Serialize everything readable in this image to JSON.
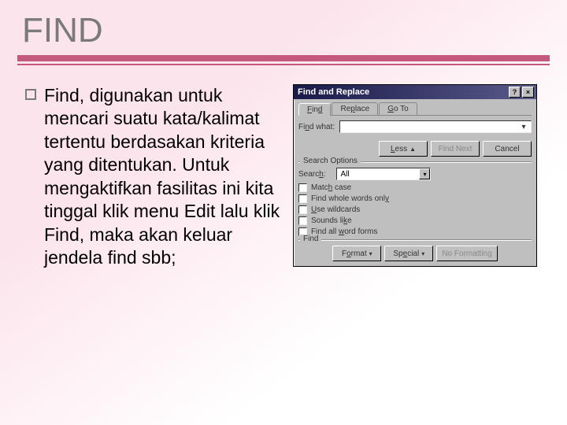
{
  "slide": {
    "title": "FIND",
    "body_text": "Find, digunakan untuk mencari suatu kata/kalimat tertentu berdasakan kriteria yang ditentukan. Untuk mengaktifkan fasilitas ini kita tinggal klik menu Edit lalu klik Find, maka akan keluar jendela find sbb;"
  },
  "dialog": {
    "title": "Find and Replace",
    "help_btn": "?",
    "close_btn": "×",
    "tabs": {
      "find": "Find",
      "replace": "Replace",
      "goto": "Go To"
    },
    "find_what_label": "Find what:",
    "find_value": "",
    "buttons": {
      "less": "Less",
      "less_glyph": "▲",
      "find_next": "Find Next",
      "cancel": "Cancel"
    },
    "search_options_label": "Search Options",
    "search_label": "Search:",
    "search_value": "All",
    "checks": {
      "match_case": "Match case",
      "whole_words": "Find whole words only",
      "wildcards": "Use wildcards",
      "sounds_like": "Sounds like",
      "word_forms": "Find all word forms"
    },
    "find_group_label": "Find",
    "bottom": {
      "format": "Format",
      "special": "Special",
      "no_formatting": "No Formatting"
    }
  }
}
